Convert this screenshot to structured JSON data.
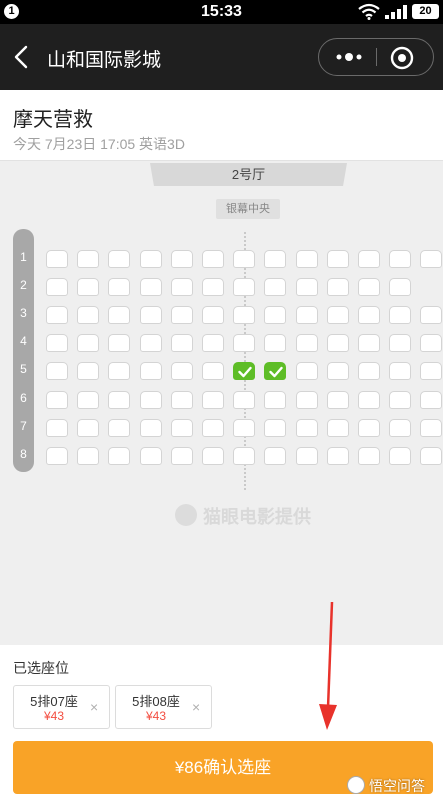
{
  "status_bar": {
    "notification": "1",
    "time": "15:33",
    "battery": "20"
  },
  "nav": {
    "title": "山和国际影城"
  },
  "movie": {
    "title": "摩天营救",
    "subtitle": "今天 7月23日 17:05 英语3D"
  },
  "hall": {
    "name": "2号厅",
    "screen_label": "银幕中央"
  },
  "seat_map": {
    "rows": [
      "1",
      "2",
      "3",
      "4",
      "5",
      "6",
      "7",
      "8"
    ],
    "seats_per_row": [
      13,
      12,
      13,
      13,
      13,
      13,
      13,
      13
    ],
    "selected": [
      {
        "row": 5,
        "index": 7
      },
      {
        "row": 5,
        "index": 8
      }
    ]
  },
  "watermark": "猫眼电影提供",
  "selection": {
    "label": "已选座位",
    "tickets": [
      {
        "seat": "5排07座",
        "price": "¥43",
        "remove": "×"
      },
      {
        "seat": "5排08座",
        "price": "¥43",
        "remove": "×"
      }
    ]
  },
  "confirm_button": "¥86确认选座",
  "brand": "悟空问答",
  "colors": {
    "accent": "#f9a327",
    "selected_seat": "#5ebd27",
    "price": "#f34d40",
    "arrow": "#e8322b"
  }
}
